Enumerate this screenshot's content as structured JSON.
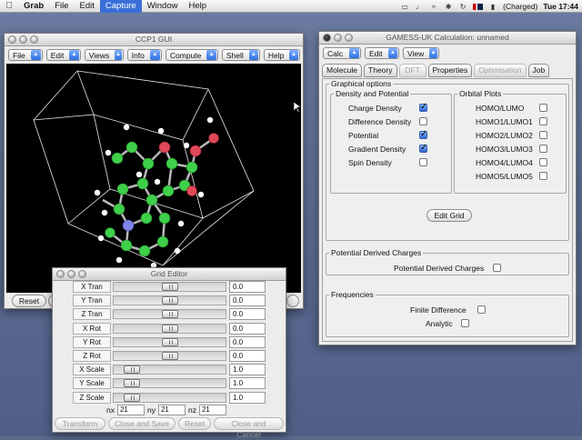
{
  "menubar": {
    "app": "Grab",
    "items": [
      "File",
      "Edit",
      "Capture",
      "Window",
      "Help"
    ],
    "active": "Capture",
    "battery": "(Charged)",
    "clock": "Tue 17:44"
  },
  "ccp1": {
    "title": "CCP1 GUI",
    "menus": [
      "File",
      "Edit",
      "Views",
      "Info",
      "Compute",
      "Shell",
      "Help"
    ],
    "reset_label": "Reset"
  },
  "gamess": {
    "title": "GAMESS-UK Calculation: unnamed",
    "menus": [
      "Calc",
      "Edit",
      "View"
    ],
    "tabs": [
      {
        "label": "Molecule",
        "enabled": true
      },
      {
        "label": "Theory",
        "enabled": true
      },
      {
        "label": "DFT",
        "enabled": false
      },
      {
        "label": "Properties",
        "enabled": true
      },
      {
        "label": "Optimisation",
        "enabled": false
      },
      {
        "label": "Job",
        "enabled": true
      }
    ],
    "graphical_options": "Graphical options",
    "density_group": "Density and Potential",
    "density_items": [
      {
        "label": "Charge Density",
        "checked": true
      },
      {
        "label": "Difference Density",
        "checked": false
      },
      {
        "label": "Potential",
        "checked": true
      },
      {
        "label": "Gradient Density",
        "checked": true
      },
      {
        "label": "Spin Density",
        "checked": false
      }
    ],
    "orbital_group": "Orbital Plots",
    "orbital_items": [
      {
        "label": "HOMO/LUMO",
        "checked": false
      },
      {
        "label": "HOMO1/LUMO1",
        "checked": false
      },
      {
        "label": "HOMO2/LUMO2",
        "checked": false
      },
      {
        "label": "HOMO3/LUMO3",
        "checked": false
      },
      {
        "label": "HOMO4/LUMO4",
        "checked": false
      },
      {
        "label": "HOMO5/LUMO5",
        "checked": false
      }
    ],
    "edit_grid": "Edit Grid",
    "pdc_group": "Potential Derived Charges",
    "pdc_item": {
      "label": "Potential Derived Charges",
      "checked": false
    },
    "freq_group": "Frequencies",
    "freq_items": [
      {
        "label": "Finite Difference",
        "checked": false
      },
      {
        "label": "Analytic",
        "checked": false
      }
    ]
  },
  "grid_editor": {
    "title": "Grid Editor",
    "rows": [
      {
        "label": "X Tran",
        "value": "0.0",
        "level": 0.5
      },
      {
        "label": "Y Tran",
        "value": "0.0",
        "level": 0.5
      },
      {
        "label": "Z Tran",
        "value": "0.0",
        "level": 0.5
      },
      {
        "label": "X Rot",
        "value": "0.0",
        "level": 0.5
      },
      {
        "label": "Y Rot",
        "value": "0.0",
        "level": 0.5
      },
      {
        "label": "Z Rot",
        "value": "0.0",
        "level": 0.5
      },
      {
        "label": "X Scale",
        "value": "1.0",
        "level": 0.1
      },
      {
        "label": "Y Scale",
        "value": "1.0",
        "level": 0.1
      },
      {
        "label": "Z Scale",
        "value": "1.0",
        "level": 0.1
      }
    ],
    "nx_label": "nx",
    "nx": "21",
    "ny_label": "ny",
    "ny": "21",
    "nz_label": "nz",
    "nz": "21",
    "buttons": [
      "Transform",
      "Close and Save",
      "Reset",
      "Close and Cancel"
    ]
  }
}
